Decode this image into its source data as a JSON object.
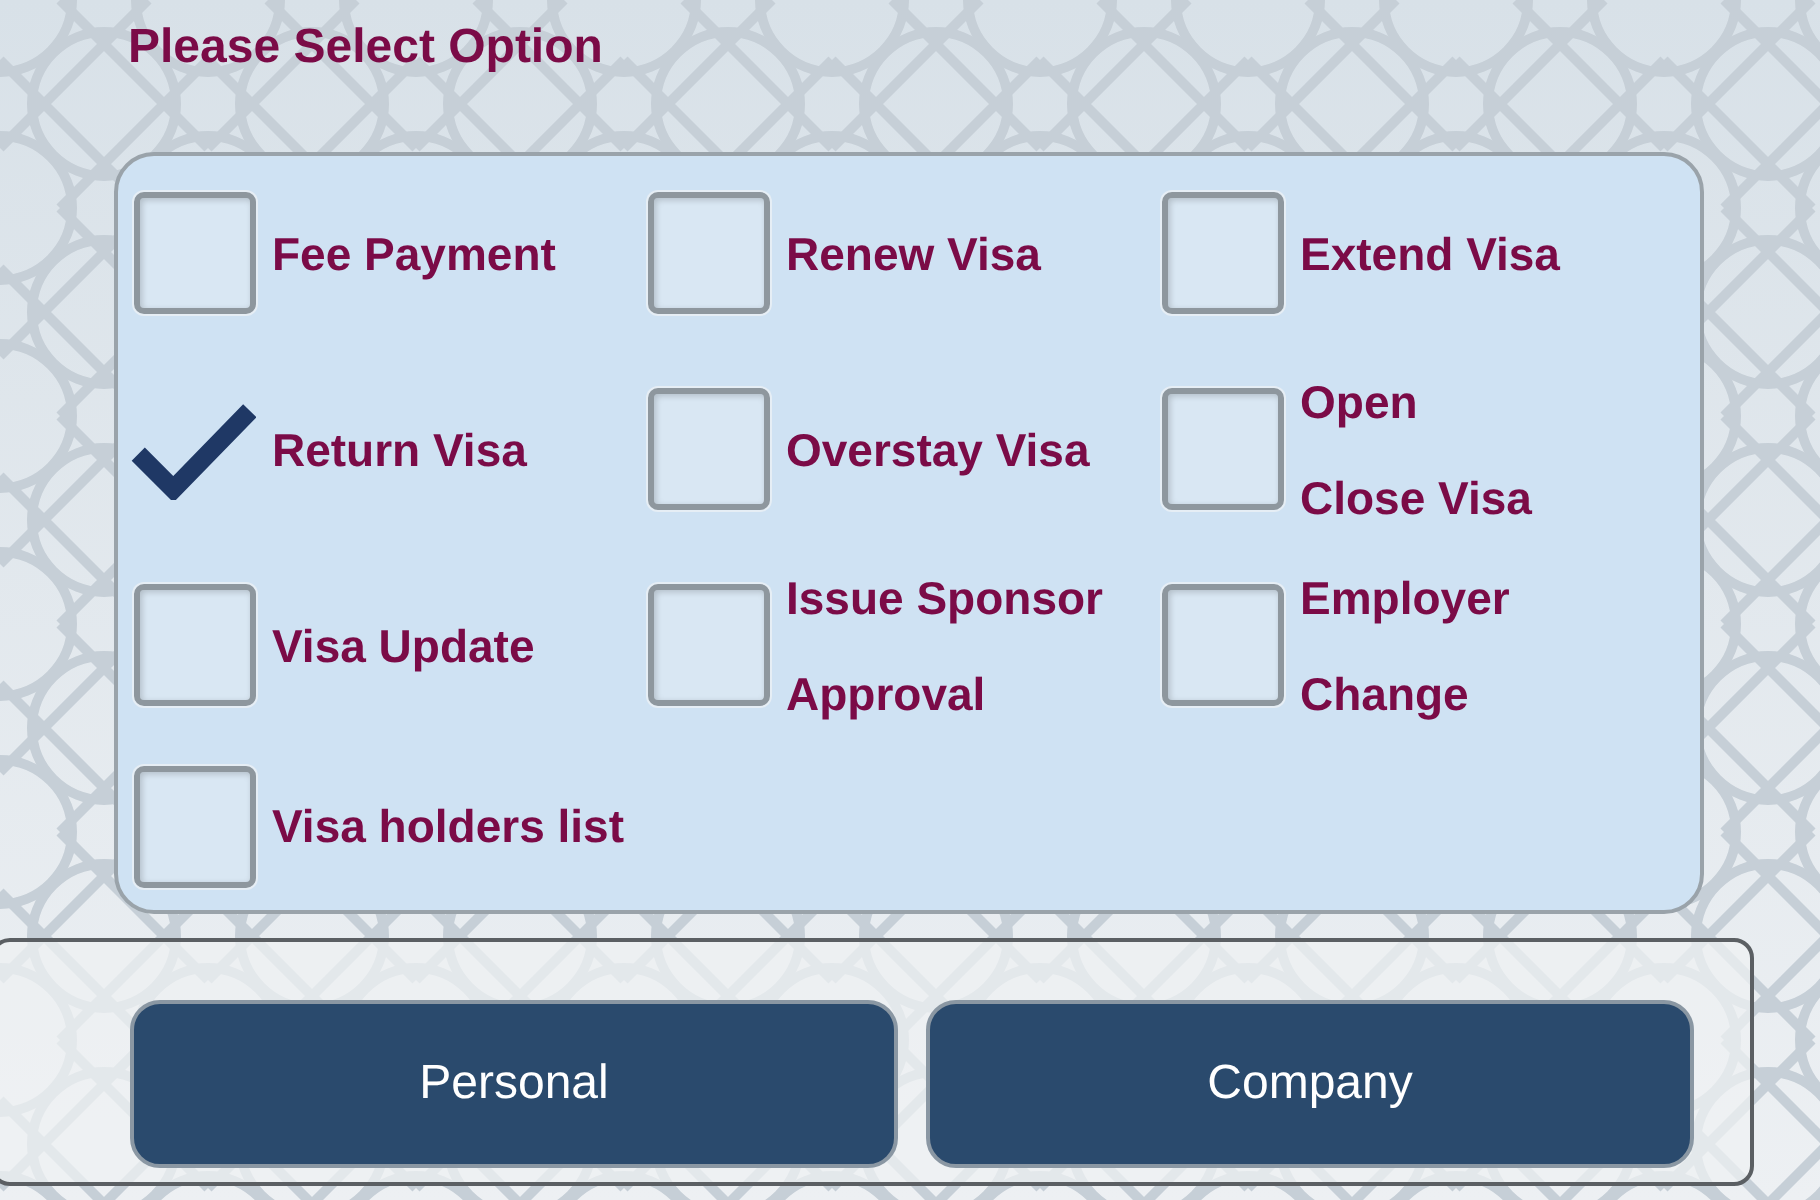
{
  "title": "Please Select Option",
  "options": [
    {
      "label": "Fee Payment",
      "checked": false
    },
    {
      "label": "Renew Visa",
      "checked": false
    },
    {
      "label": "Extend Visa",
      "checked": false
    },
    {
      "label": "Return Visa",
      "checked": true
    },
    {
      "label": "Overstay Visa",
      "checked": false
    },
    {
      "label": "Open\nClose Visa",
      "checked": false
    },
    {
      "label": "Visa Update",
      "checked": false
    },
    {
      "label": "Issue Sponsor\nApproval",
      "checked": false
    },
    {
      "label": "Employer\nChange",
      "checked": false
    },
    {
      "label": "Visa holders list",
      "checked": false
    }
  ],
  "buttons": [
    {
      "label": "Personal"
    },
    {
      "label": "Company"
    }
  ]
}
